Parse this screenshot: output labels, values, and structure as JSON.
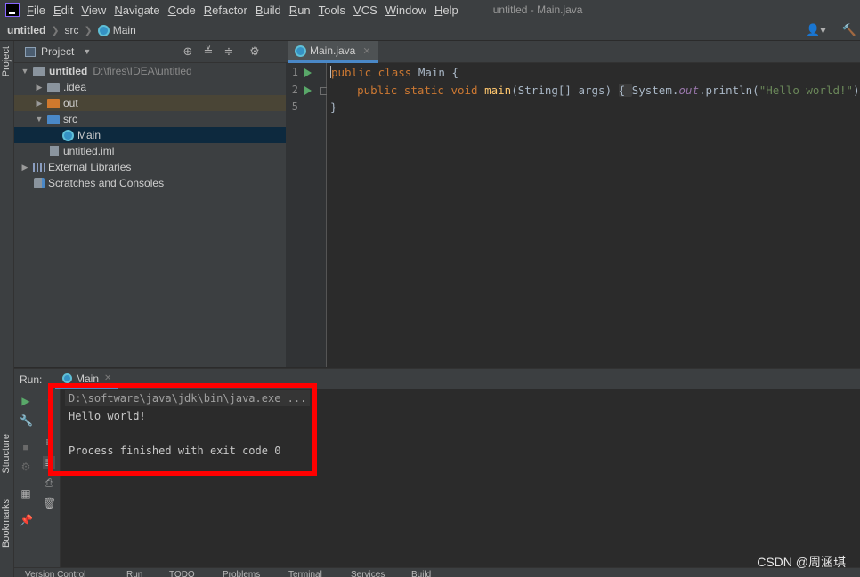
{
  "app": {
    "window_title": "untitled - Main.java"
  },
  "menu": [
    "File",
    "Edit",
    "View",
    "Navigate",
    "Code",
    "Refactor",
    "Build",
    "Run",
    "Tools",
    "VCS",
    "Window",
    "Help"
  ],
  "breadcrumb": {
    "project": "untitled",
    "folder": "src",
    "file": "Main"
  },
  "side_tabs": {
    "project": "Project",
    "structure": "Structure",
    "bookmarks": "Bookmarks"
  },
  "project_panel": {
    "title": "Project",
    "tree": [
      {
        "label": "untitled",
        "path": "D:\\fires\\IDEA\\untitled"
      },
      {
        "label": ".idea"
      },
      {
        "label": "out"
      },
      {
        "label": "src"
      },
      {
        "label": "Main"
      },
      {
        "label": "untitled.iml"
      },
      {
        "label": "External Libraries"
      },
      {
        "label": "Scratches and Consoles"
      }
    ]
  },
  "editor": {
    "tab_label": "Main.java",
    "line_numbers": [
      "1",
      "2",
      "5"
    ]
  },
  "run_panel": {
    "label": "Run:",
    "tab_label": "Main",
    "console": {
      "command": "D:\\software\\java\\jdk\\bin\\java.exe ...",
      "output": "Hello world!",
      "exit": "Process finished with exit code 0"
    }
  },
  "bottom_tabs": [
    "Version Control",
    "Run",
    "TODO",
    "Problems",
    "Terminal",
    "Services",
    "Build"
  ],
  "watermark": "CSDN @周涵琪",
  "colors": {
    "accent": "#4a88c7",
    "highlight_box": "#ff0000",
    "run_green": "#59a869"
  }
}
